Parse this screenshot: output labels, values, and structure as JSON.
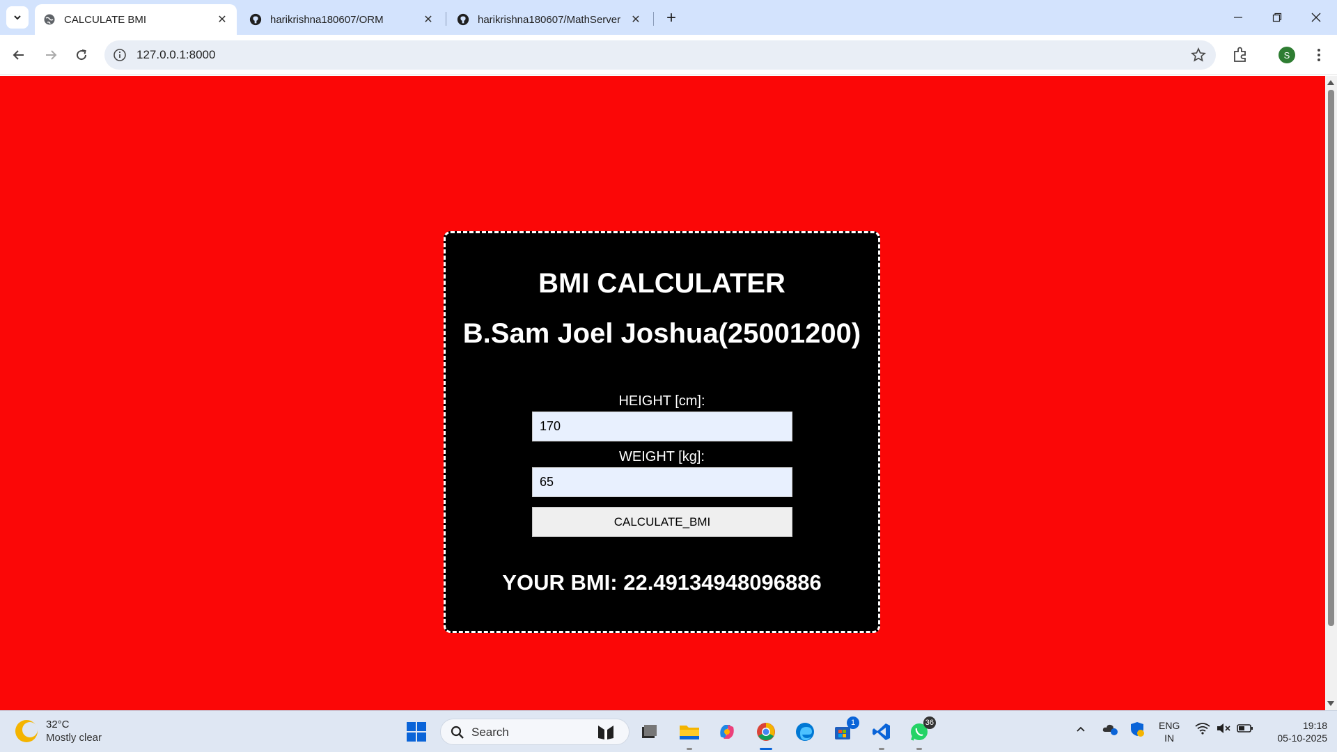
{
  "browser": {
    "tabs": [
      {
        "title": "CALCULATE BMI",
        "active": true
      },
      {
        "title": "harikrishna180607/ORM",
        "active": false
      },
      {
        "title": "harikrishna180607/MathServer",
        "active": false
      }
    ],
    "url": "127.0.0.1:8000",
    "profile_initial": "S"
  },
  "page": {
    "background_color": "#fb0707",
    "card": {
      "title": "BMI CALCULATER",
      "name": "B.Sam Joel Joshua(25001200)",
      "height_label": "HEIGHT [cm]:",
      "height_value": "170",
      "weight_label": "WEIGHT [kg]:",
      "weight_value": "65",
      "button_label": "CALCULATE_BMI",
      "result": "YOUR BMI: 22.49134948096886"
    }
  },
  "taskbar": {
    "weather": {
      "temp": "32°C",
      "condition": "Mostly clear"
    },
    "search_label": "Search",
    "badges": {
      "store": "1",
      "whatsapp": "36"
    },
    "language": {
      "line1": "ENG",
      "line2": "IN"
    },
    "time": "19:18",
    "date": "05-10-2025"
  }
}
